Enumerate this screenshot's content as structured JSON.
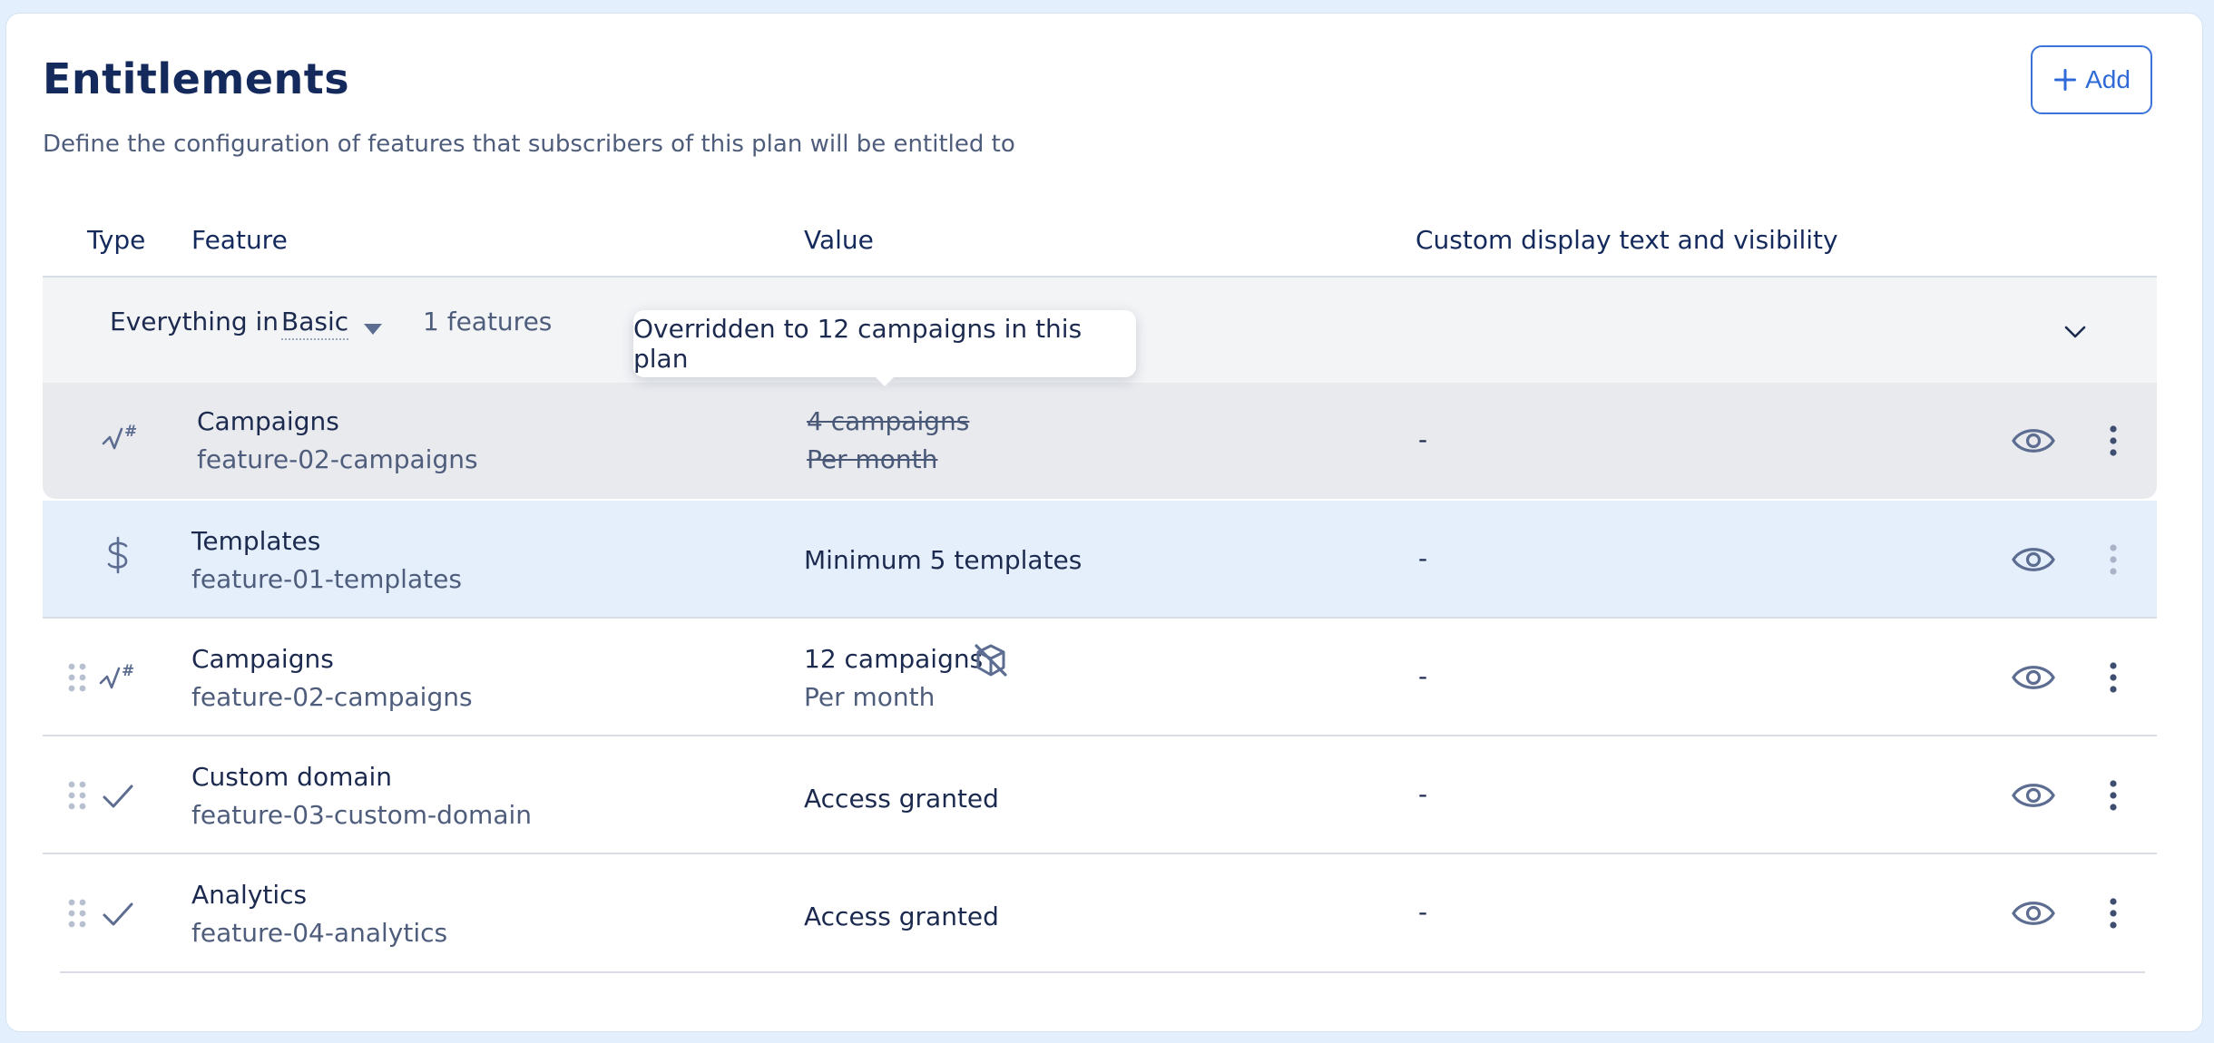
{
  "page": {
    "title": "Entitlements",
    "subtitle": "Define the configuration of features that subscribers of this plan will be entitled to",
    "add_label": "Add"
  },
  "table": {
    "columns": [
      "Type",
      "Feature",
      "Value",
      "Custom display text and visibility"
    ]
  },
  "group": {
    "prefix": "Everything in",
    "plan": "Basic",
    "count": "1 features"
  },
  "tooltip": "Overridden to 12 campaigns in this plan",
  "inherited_row": {
    "type_icon": "metered-icon",
    "name": "Campaigns",
    "key": "feature-02-campaigns",
    "value_main": "4 campaigns",
    "value_sub": "Per month",
    "custom_text": "-"
  },
  "rows": [
    {
      "type_icon": "dollar-icon",
      "name": "Templates",
      "key": "feature-01-templates",
      "value_main": "Minimum 5 templates",
      "custom_text": "-"
    },
    {
      "type_icon": "metered-icon",
      "name": "Campaigns",
      "key": "feature-02-campaigns",
      "value_main": "12 campaigns",
      "value_sub": "Per month",
      "override_icon": "override-box-icon",
      "custom_text": "-"
    },
    {
      "type_icon": "check-icon",
      "name": "Custom domain",
      "key": "feature-03-custom-domain",
      "value_main": "Access granted",
      "custom_text": "-"
    },
    {
      "type_icon": "check-icon",
      "name": "Analytics",
      "key": "feature-04-analytics",
      "value_main": "Access granted",
      "custom_text": "-"
    }
  ],
  "colors": {
    "accent": "#2f6ad6",
    "background": "#e3effc",
    "highlight_row": "#e4effb",
    "group_bg": "#f3f4f6",
    "icon": "#5d6d91"
  }
}
